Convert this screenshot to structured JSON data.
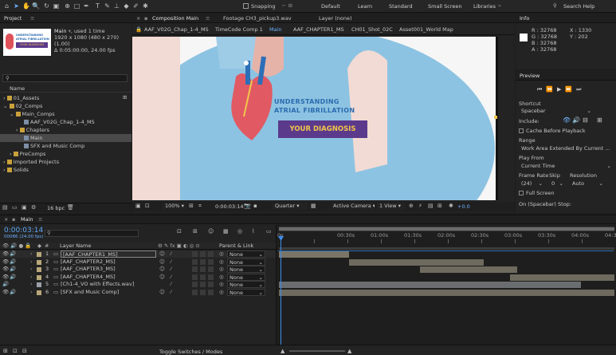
{
  "toolbar": {
    "snapping_label": "Snapping",
    "workspaces": [
      "Default",
      "Learn",
      "Standard",
      "Small Screen",
      "Libraries"
    ],
    "search_placeholder": "Search Help"
  },
  "project": {
    "title": "Project",
    "comp_name": "Main",
    "used": ", used 1 time",
    "dims": "1920 x 1080 (480 x 270) (1.00)",
    "duration": "Δ 0:05:00:00, 24.00 fps",
    "thumb_title_line1": "UNDERSTANDING",
    "thumb_title_line2": "ATRIAL FIBRILLATION",
    "thumb_badge": "YOUR DIAGNOSIS",
    "col_name": "Name",
    "items": [
      {
        "label": "01_Assets"
      },
      {
        "label": "02_Comps"
      },
      {
        "label": "Main_Comps"
      },
      {
        "label": "AAF_V02G_Chap_1-4_MS"
      },
      {
        "label": "Chapters"
      },
      {
        "label": "Main"
      },
      {
        "label": "SFX and Music Comp"
      },
      {
        "label": "PreComps"
      },
      {
        "label": "Imported Projects"
      },
      {
        "label": "Solids"
      }
    ],
    "bpc": "16 bpc"
  },
  "viewer": {
    "tabs": [
      "Composition Main",
      "Footage CH3_pickup3.wav",
      "Layer (none)"
    ],
    "breadcrumbs": [
      "AAF_V02G_Chap_1-4_MS",
      "TimeCode Comp 1",
      "Main",
      "AAF_CHAPTER1_MS",
      "CH01_Shot_02C",
      "Asset001_World Map"
    ],
    "title_line1": "UNDERSTANDING",
    "title_line2": "ATRIAL FIBRILLATION",
    "badge": "YOUR DIAGNOSIS",
    "zoom": "100%",
    "timecode": "0:00:03:14",
    "resolution": "Quarter",
    "camera": "Active Camera",
    "view": "1 View",
    "exposure": "+0.0"
  },
  "info": {
    "title": "Info",
    "r": "R : 32768",
    "g": "G : 32768",
    "b": "B : 32768",
    "a": "A : 32768",
    "x": "X : 1330",
    "y": "Y : 202"
  },
  "preview": {
    "title": "Preview",
    "shortcut_label": "Shortcut",
    "shortcut_value": "Spacebar",
    "include_label": "Include:",
    "cache_label": "Cache Before Playback",
    "range_label": "Range",
    "range_value": "Work Area Extended By Current ...",
    "playfrom_label": "Play From",
    "playfrom_value": "Current Time",
    "framerate_label": "Frame Rate",
    "skip_label": "Skip",
    "resolution_label": "Resolution",
    "framerate_value": "(24)",
    "skip_value": "0",
    "resolution_value": "Auto",
    "fullscreen_label": "Full Screen",
    "onstop_label": "On (Spacebar) Stop:"
  },
  "timeline": {
    "tab": "Main",
    "timecode": "0:00:03:14",
    "frames": "00086 (24.00 fps)",
    "col_layer_name": "Layer Name",
    "col_parent": "Parent & Link",
    "toggle_label": "Toggle Switches / Modes",
    "ticks": [
      "0s",
      "00:30s",
      "01:00s",
      "01:30s",
      "02:00s",
      "02:30s",
      "03:00s",
      "03:30s",
      "04:00s",
      "04:30s"
    ],
    "layers": [
      {
        "num": "1",
        "name": "[AAF_CHAPTER1_MS]",
        "parent": "None",
        "color": "#b8a77a",
        "bar_start": 0.0,
        "bar_end": 0.21
      },
      {
        "num": "2",
        "name": "[AAF_CHAPTER2_MS]",
        "parent": "None",
        "color": "#b8a77a",
        "bar_start": 0.21,
        "bar_end": 0.61
      },
      {
        "num": "3",
        "name": "[AAF_CHAPTER3_MS]",
        "parent": "None",
        "color": "#b8a77a",
        "bar_start": 0.42,
        "bar_end": 0.71
      },
      {
        "num": "4",
        "name": "[AAF_CHAPTER4_MS]",
        "parent": "None",
        "color": "#b8a77a",
        "bar_start": 0.69,
        "bar_end": 1.0
      },
      {
        "num": "5",
        "name": "[Ch1-4_VO with Effects.wav]",
        "parent": "None",
        "color": "#9aa1a8",
        "bar_start": 0.0,
        "bar_end": 0.9
      },
      {
        "num": "6",
        "name": "[SFX and Music Comp]",
        "parent": "None",
        "color": "#b8a77a",
        "bar_start": 0.0,
        "bar_end": 1.0
      }
    ]
  },
  "colors": {
    "accent": "#2d8ceb",
    "badge": "#5b3a8c",
    "label_tan": "#b8a77a"
  }
}
